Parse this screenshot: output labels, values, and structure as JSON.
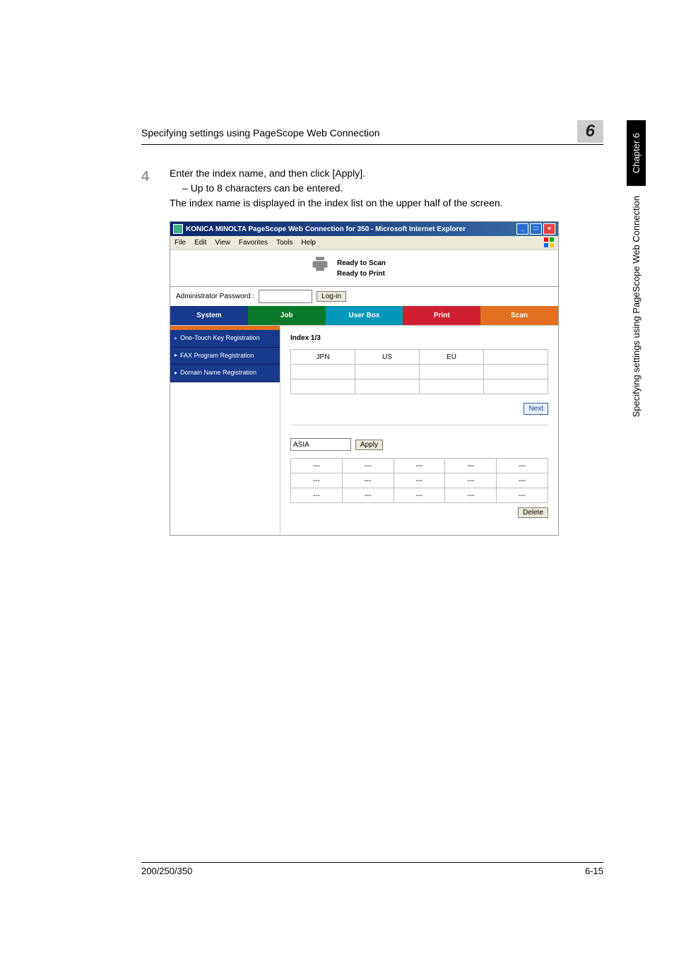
{
  "header": {
    "title": "Specifying settings using PageScope Web Connection",
    "chapter_num": "6"
  },
  "sidebar": {
    "chapter_label": "Chapter 6",
    "section_label": "Specifying settings using PageScope Web Connection"
  },
  "step": {
    "number": "4",
    "text": "Enter the index name, and then click [Apply].",
    "bullet": "Up to 8 characters can be entered.",
    "note": "The index name is displayed in the index list on the upper half of the screen."
  },
  "ie": {
    "title": "KONICA MINOLTA PageScope Web Connection for 350 - Microsoft Internet Explorer",
    "menu": [
      "File",
      "Edit",
      "View",
      "Favorites",
      "Tools",
      "Help"
    ]
  },
  "status": {
    "line1": "Ready to Scan",
    "line2": "Ready to Print"
  },
  "admin": {
    "label": "Administrator Password :",
    "login_btn": "Log-in"
  },
  "tabs": {
    "system": "System",
    "job": "Job",
    "userbox": "User Box",
    "print": "Print",
    "scan": "Scan"
  },
  "nav": {
    "items": [
      "One-Touch Key Registration",
      "FAX Program Registration",
      "Domain Name Registration"
    ]
  },
  "panel": {
    "index_label": "Index 1/3",
    "index_cells": [
      "JPN",
      "US",
      "EU",
      ""
    ],
    "next_btn": "Next",
    "apply_value": "ASIA",
    "apply_btn": "Apply",
    "lower_rows": [
      [
        "---",
        "---",
        "---",
        "---",
        "---"
      ],
      [
        "---",
        "---",
        "---",
        "---",
        "---"
      ],
      [
        "---",
        "---",
        "---",
        "---",
        "---"
      ]
    ],
    "delete_btn": "Delete"
  },
  "footer": {
    "left": "200/250/350",
    "right": "6-15"
  }
}
